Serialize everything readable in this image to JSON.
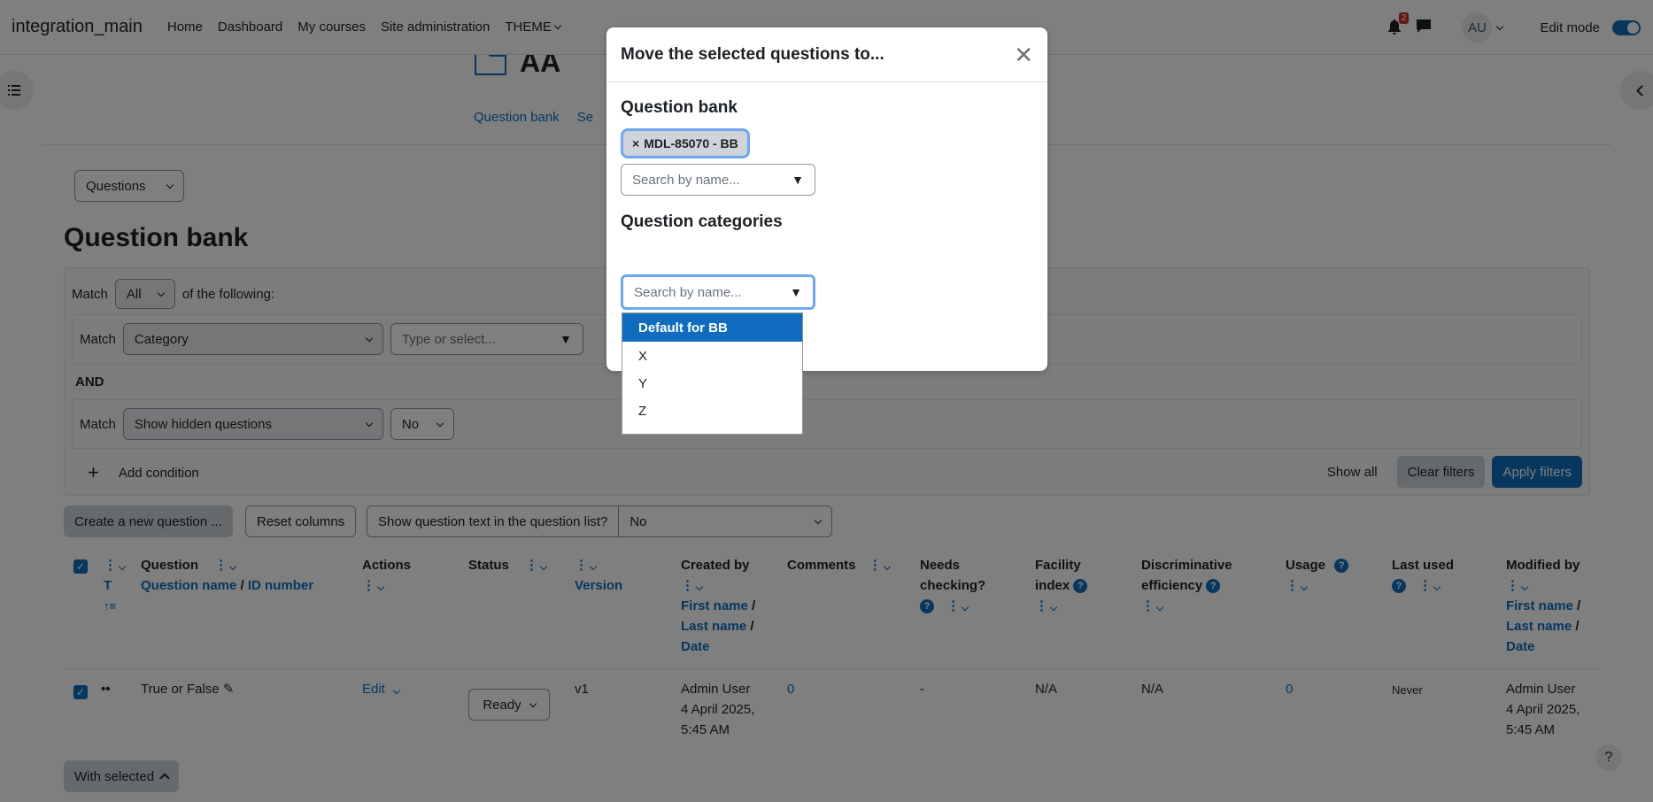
{
  "navbar": {
    "site_name": "integration_main",
    "links": [
      "Home",
      "Dashboard",
      "My courses",
      "Site administration",
      "THEME"
    ],
    "notification_count": "2",
    "avatar_initials": "AU",
    "edit_mode_label": "Edit mode"
  },
  "course": {
    "title": "AA",
    "tabs": [
      "Question bank",
      "Se"
    ]
  },
  "page": {
    "view_select": "Questions",
    "heading": "Question bank"
  },
  "filters": {
    "match_label": "Match",
    "match_all": "All",
    "of_following": "of the following:",
    "cond1_match": "Match",
    "cond1_type": "Category",
    "cond1_value_placeholder": "Type or select...",
    "and_label": "AND",
    "cond2_match": "Match",
    "cond2_type": "Show hidden questions",
    "cond2_value": "No",
    "add_condition": "Add condition",
    "show_all": "Show all",
    "clear_filters": "Clear filters",
    "apply_filters": "Apply filters"
  },
  "toolbar": {
    "create_new": "Create a new question ...",
    "reset_columns": "Reset columns",
    "show_text_label": "Show question text in the question list?",
    "show_text_value": "No"
  },
  "table": {
    "headers": {
      "t": "T",
      "question": "Question",
      "question_name": "Question name",
      "slash": "/",
      "id_number": "ID number",
      "actions": "Actions",
      "status": "Status",
      "version": "Version",
      "created_by": "Created by",
      "first_name": "First name",
      "last_name": "Last name",
      "date": "Date",
      "comments": "Comments",
      "needs_checking_1": "Needs",
      "needs_checking_2": "checking?",
      "facility_1": "Facility",
      "facility_2": "index",
      "discrim_1": "Discriminative",
      "discrim_2": "efficiency",
      "usage": "Usage",
      "last_used": "Last used",
      "modified_by": "Modified by"
    },
    "rows": [
      {
        "question": "True or False",
        "action": "Edit",
        "status": "Ready",
        "version": "v1",
        "created_name": "Admin User",
        "created_date": "4 April 2025,",
        "created_time": "5:45 AM",
        "comments": "0",
        "needs_checking": "-",
        "facility": "N/A",
        "discrim": "N/A",
        "usage": "0",
        "last_used": "Never",
        "modified_name": "Admin User",
        "modified_date": "4 April 2025,",
        "modified_time": "5:45 AM"
      }
    ]
  },
  "footer": {
    "with_selected": "With selected"
  },
  "modal": {
    "title": "Move the selected questions to...",
    "bank_heading": "Question bank",
    "bank_tag": "MDL-85070 - BB",
    "bank_placeholder": "Search by name...",
    "categories_heading": "Question categories",
    "categories_placeholder": "Search by name...",
    "options": [
      "Default for BB",
      "X",
      "Y",
      "Z"
    ]
  },
  "colors": {
    "primary": "#0f6cbf",
    "focus_ring": "#6ea8f0",
    "notification": "#ca3120"
  }
}
